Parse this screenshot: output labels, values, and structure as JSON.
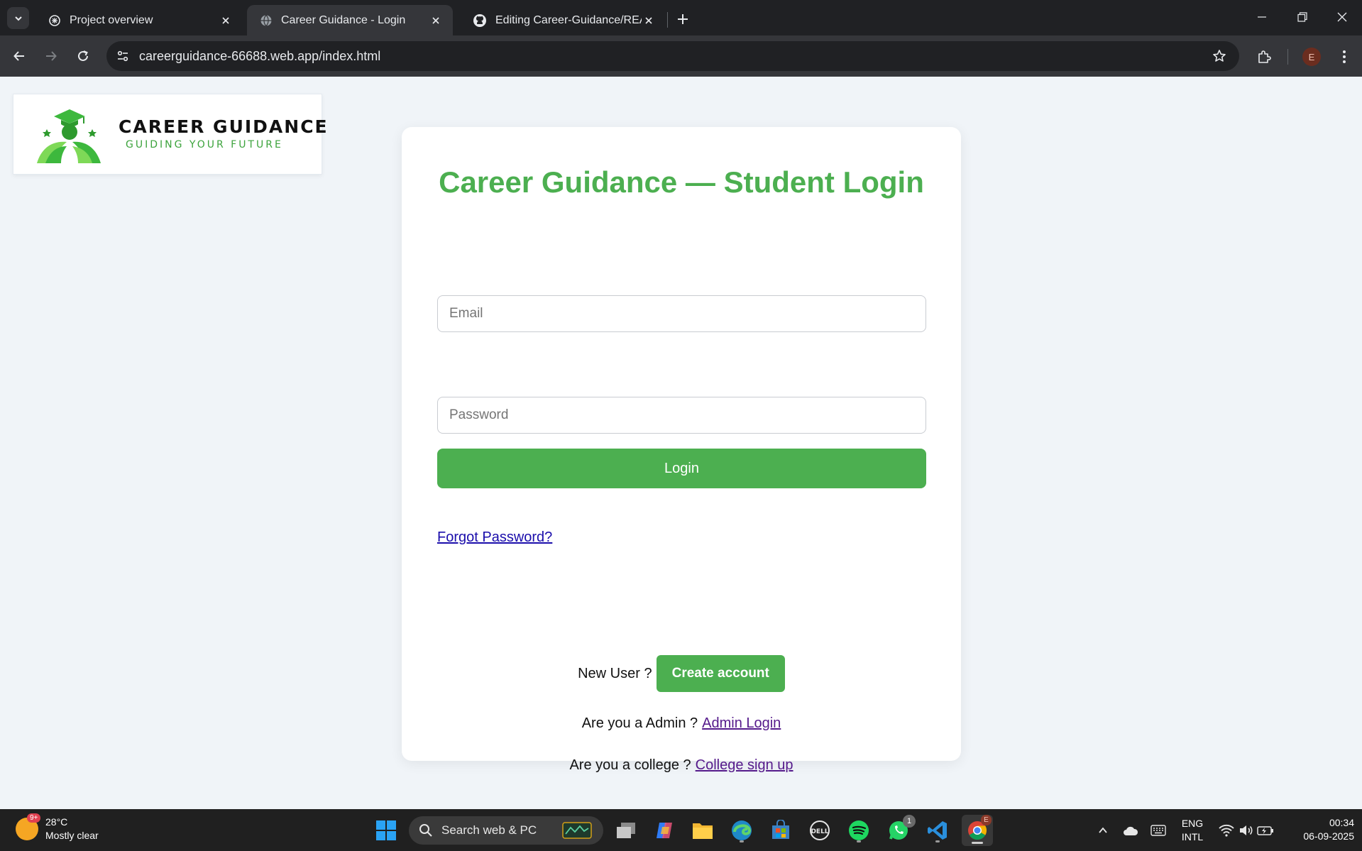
{
  "browser": {
    "tabs": [
      {
        "title": "Project overview",
        "active": false
      },
      {
        "title": "Career Guidance - Login",
        "active": true
      },
      {
        "title": "Editing Career-Guidance/READM",
        "active": false
      }
    ],
    "url": "careerguidance-66688.web.app/index.html",
    "profile_initial": "E"
  },
  "page": {
    "logo": {
      "line1": "CAREER GUIDANCE",
      "line2": "GUIDING YOUR FUTURE",
      "brand_green": "#4caf50"
    },
    "title": "Career Guidance — Student Login",
    "email_placeholder": "Email",
    "password_placeholder": "Password",
    "login_label": "Login",
    "forgot_label": "Forgot Password?",
    "new_user_text": "New User ?",
    "create_account_label": "Create account",
    "admin_text": "Are you a Admin ?",
    "admin_link": "Admin Login",
    "college_text": "Are you a college ?",
    "college_link": "College sign up"
  },
  "taskbar": {
    "weather_badge": "9+",
    "temperature": "28°C",
    "condition": "Mostly clear",
    "search_placeholder": "Search web & PC",
    "whatsapp_badge": "1",
    "chrome_badge": "E",
    "lang_line1": "ENG",
    "lang_line2": "INTL",
    "time": "00:34",
    "date": "06-09-2025"
  }
}
